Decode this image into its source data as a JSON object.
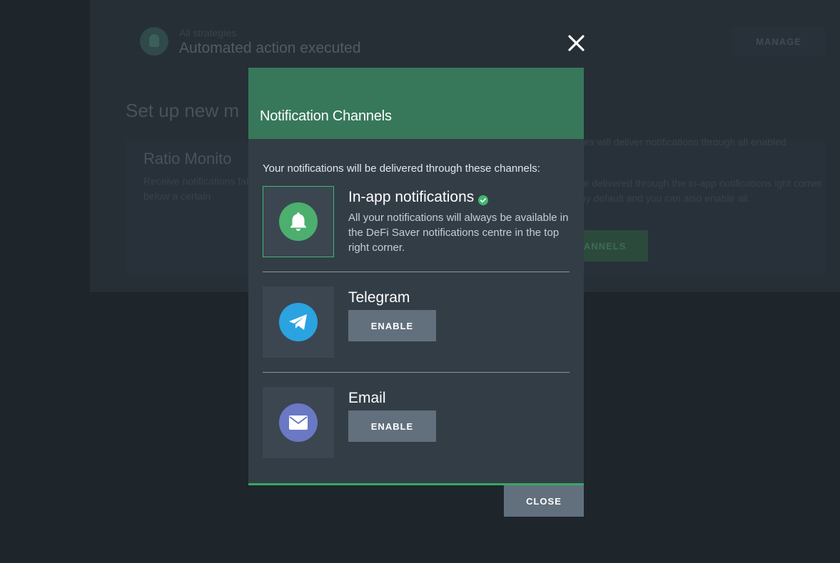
{
  "background": {
    "strategy_label": "All strategies",
    "event_title": "Automated action executed",
    "manage_label": "MANAGE",
    "setup_title": "Set up new m",
    "ratio_title": "Ratio Monito",
    "ratio_desc": "Receive notifications falls below a certain",
    "right_text_1": "ors will deliver notifications through all enabled",
    "right_text_2": "re delivered through the in-app notifications ight corner by default and you can also enable ail.",
    "channels_button_label": "ANNELS"
  },
  "modal": {
    "title": "Notification Channels",
    "intro": "Your notifications will be delivered through these channels:",
    "close_label": "CLOSE",
    "channels": [
      {
        "name": "In-app notifications",
        "enabled": true,
        "description": "All your notifications will always be available in the DeFi Saver notifications centre in the top right corner.",
        "icon": "bell-icon",
        "color": "#4caf6d"
      },
      {
        "name": "Telegram",
        "enabled": false,
        "button_label": "ENABLE",
        "icon": "telegram-icon",
        "color": "#2aa3e0"
      },
      {
        "name": "Email",
        "enabled": false,
        "button_label": "ENABLE",
        "icon": "mail-icon",
        "color": "#6b78c4"
      }
    ]
  },
  "colors": {
    "header_green": "#37785a",
    "accent_green": "#37a664",
    "button_gray": "#62707d"
  }
}
